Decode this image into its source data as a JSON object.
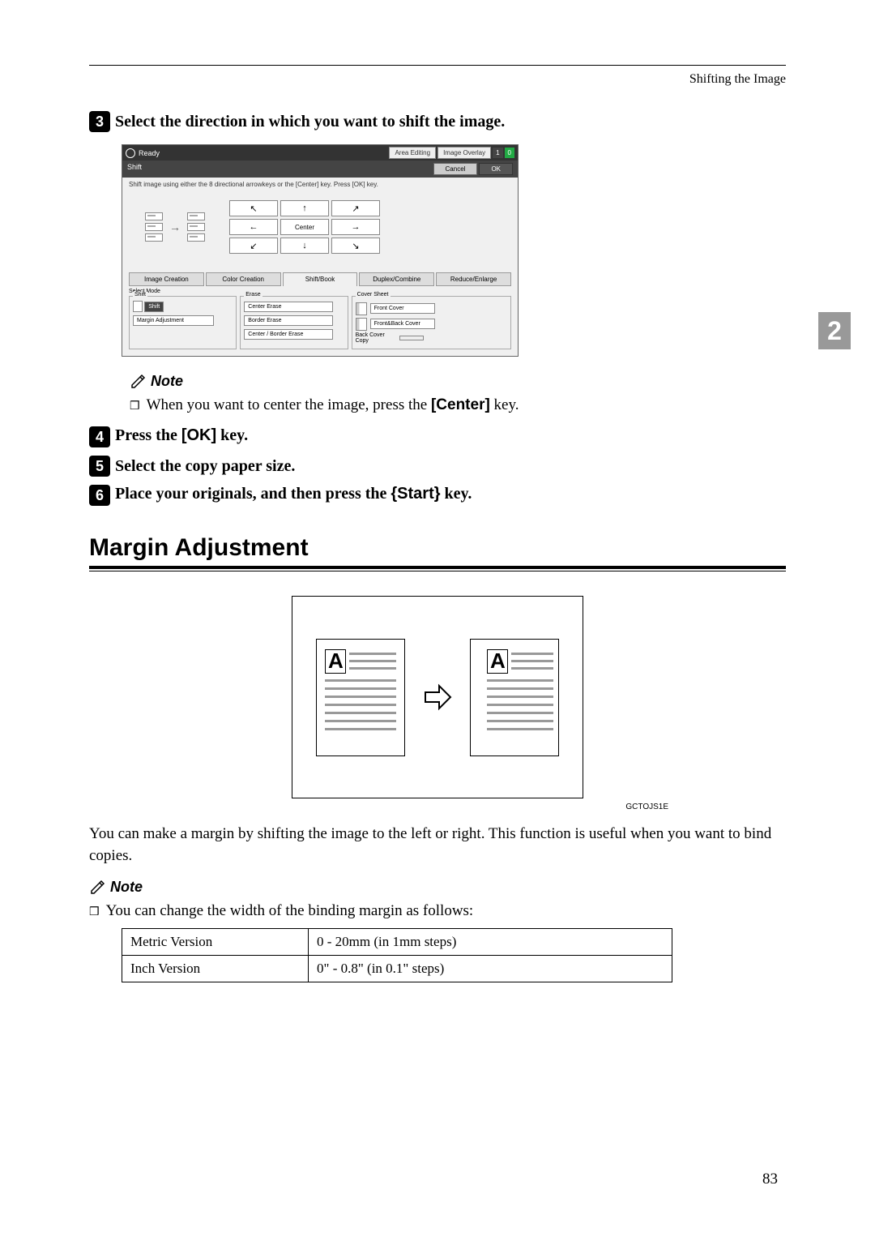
{
  "header": {
    "title": "Shifting the Image"
  },
  "sideTab": "2",
  "steps": {
    "s3": {
      "num": "3",
      "text": "Select the direction in which you want to shift the image."
    },
    "s4": {
      "num": "4",
      "prefix": "Press the ",
      "key": "[OK]",
      "suffix": " key."
    },
    "s5": {
      "num": "5",
      "text": "Select the copy paper size."
    },
    "s6": {
      "num": "6",
      "prefix": "Place your originals, and then press the ",
      "key": "{Start}",
      "suffix": " key."
    }
  },
  "dialog": {
    "headerLabel": "Ready",
    "areaEditing": "Area Editing",
    "imageOverlay": "Image Overlay",
    "count1": "1",
    "count0": "0",
    "shiftLabel": "Shift",
    "cancel": "Cancel",
    "ok": "OK",
    "hint": "Shift image using either the 8 directional arrowkeys or the [Center] key.\nPress [OK] key.",
    "center": "Center",
    "tabs": {
      "imageCreation": "Image Creation",
      "colorCreation": "Color Creation",
      "shiftBook": "Shift/Book",
      "duplexCombine": "Duplex/Combine",
      "reduceEnlarge": "Reduce/Enlarge"
    },
    "panels": {
      "selectMode": "Select Mode",
      "shiftGroup": "Shift",
      "shift": "Shift",
      "marginAdjustment": "Margin Adjustment",
      "eraseGroup": "Erase",
      "centerErase": "Center Erase",
      "borderErase": "Border Erase",
      "centerBorder": "Center / Border Erase",
      "coverGroup": "Cover Sheet",
      "frontCover": "Front Cover",
      "frontBack": "Front&Back Cover",
      "backCover": "Back Cover\nCopy"
    }
  },
  "note1": {
    "heading": "Note",
    "text": "When you want to center the image, press the ",
    "key": "[Center]",
    "suffix": " key."
  },
  "section": {
    "heading": "Margin Adjustment"
  },
  "diagram": {
    "letterA": "A",
    "caption": "GCTOJS1E"
  },
  "bodyText": "You can make a margin by shifting the image to the left or right. This function is useful when you want to bind copies.",
  "note2": {
    "heading": "Note",
    "text": "You can change the width of the binding margin as follows:"
  },
  "table": {
    "row1": {
      "label": "Metric Version",
      "value": "0 - 20mm (in 1mm steps)"
    },
    "row2": {
      "label": "Inch Version",
      "value": "0\" - 0.8\" (in 0.1\" steps)"
    }
  },
  "pageNumber": "83"
}
